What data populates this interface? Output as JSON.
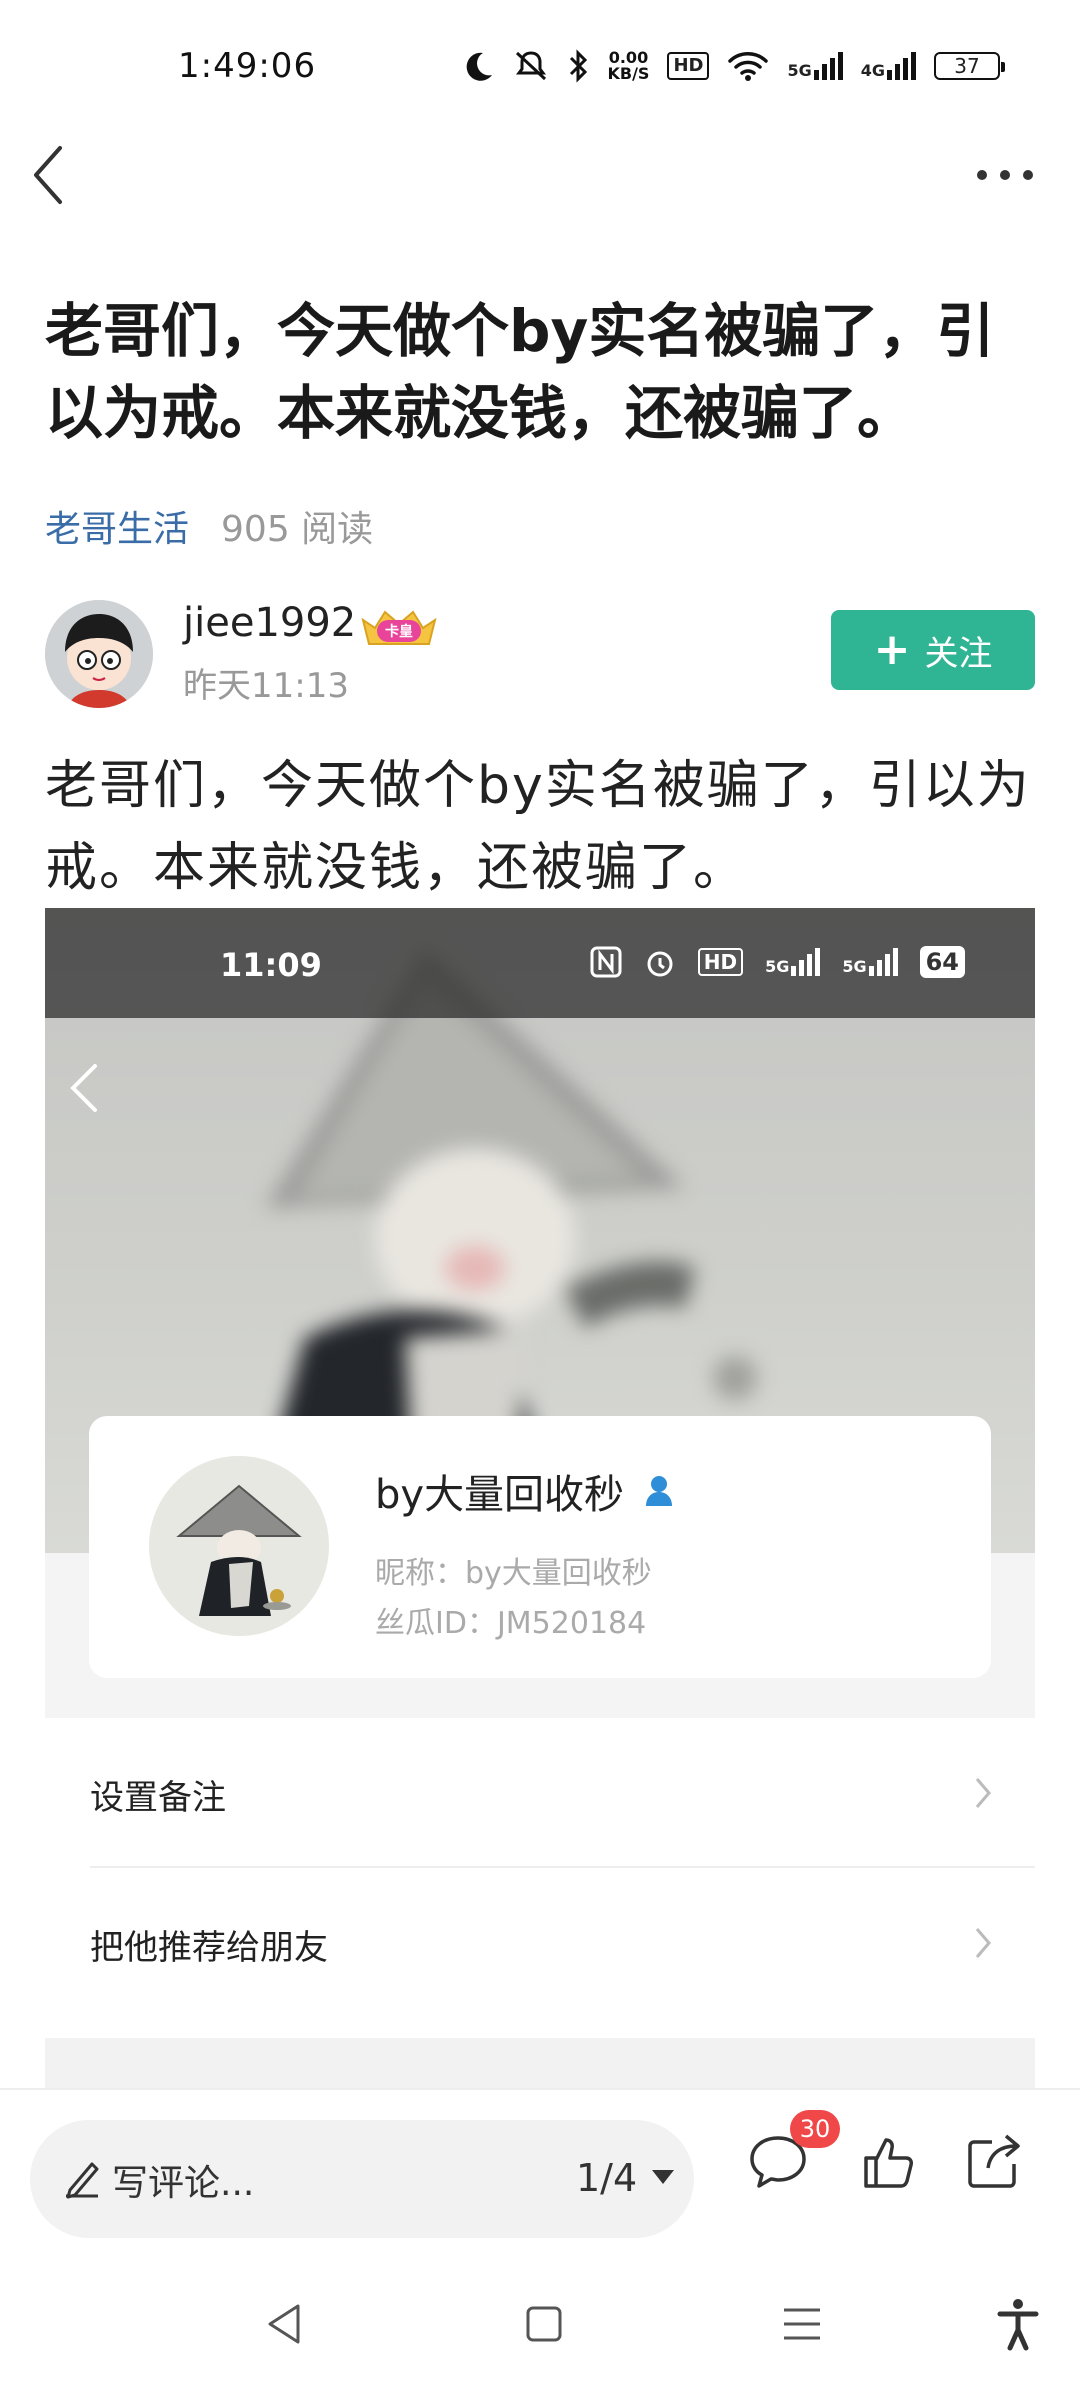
{
  "status_bar": {
    "time": "1:49:06",
    "net_speed_value": "0.00",
    "net_speed_unit": "KB/S",
    "hd_label": "HD",
    "sig1_label": "5G",
    "sig2_label": "4G",
    "battery": "37"
  },
  "article": {
    "title": "老哥们，今天做个by实名被骗了，引以为戒。本来就没钱，还被骗了。",
    "category": "老哥生活",
    "reads": "905 阅读",
    "author": "jiee1992",
    "vip_badge": "卡皇",
    "post_time": "昨天11:13",
    "follow_label": "关注",
    "body": "老哥们，今天做个by实名被骗了，引以为戒。本来就没钱，还被骗了。"
  },
  "screenshot": {
    "time": "11:09",
    "hd_label": "HD",
    "sig_label": "5G",
    "battery": "64",
    "profile_name": "by大量回收秒",
    "nickname": "昵称：by大量回收秒",
    "user_id": "丝瓜ID：JM520184",
    "menu": [
      "设置备注",
      "把他推荐给朋友"
    ]
  },
  "bottom_bar": {
    "comment_placeholder": "写评论...",
    "page_indicator": "1/4",
    "comment_count": "30"
  },
  "colors": {
    "accent": "#2fb593",
    "link": "#3a6da8",
    "badge": "#f04848"
  }
}
